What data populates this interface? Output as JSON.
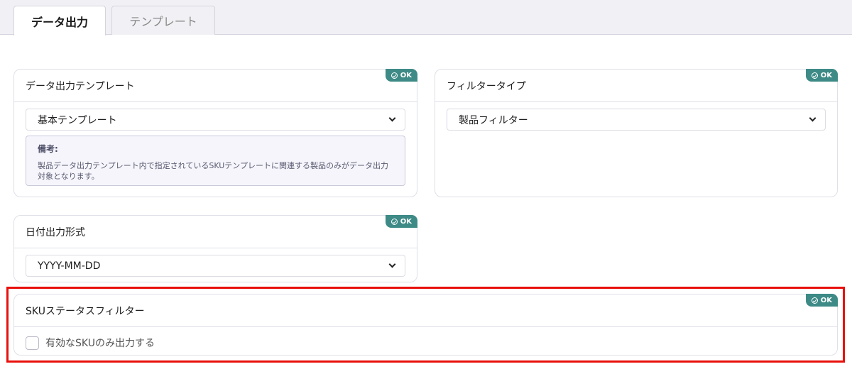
{
  "tabs": [
    {
      "label": "データ出力",
      "active": true
    },
    {
      "label": "テンプレート",
      "active": false
    }
  ],
  "badge": {
    "label": "OK",
    "color": "#3d8a86"
  },
  "cards": {
    "template": {
      "title": "データ出力テンプレート",
      "selected": "基本テンプレート",
      "note_title": "備考:",
      "note_text": "製品データ出力テンプレート内で指定されているSKUテンプレートに関連する製品のみがデータ出力対象となります。"
    },
    "filter_type": {
      "title": "フィルタータイプ",
      "selected": "製品フィルター"
    },
    "date_format": {
      "title": "日付出力形式",
      "selected": "YYYY-MM-DD"
    },
    "sku_status": {
      "title": "SKUステータスフィルター",
      "checkbox_label": "有効なSKUのみ出力する",
      "checked": false
    }
  },
  "highlight_color": "#e8100c"
}
